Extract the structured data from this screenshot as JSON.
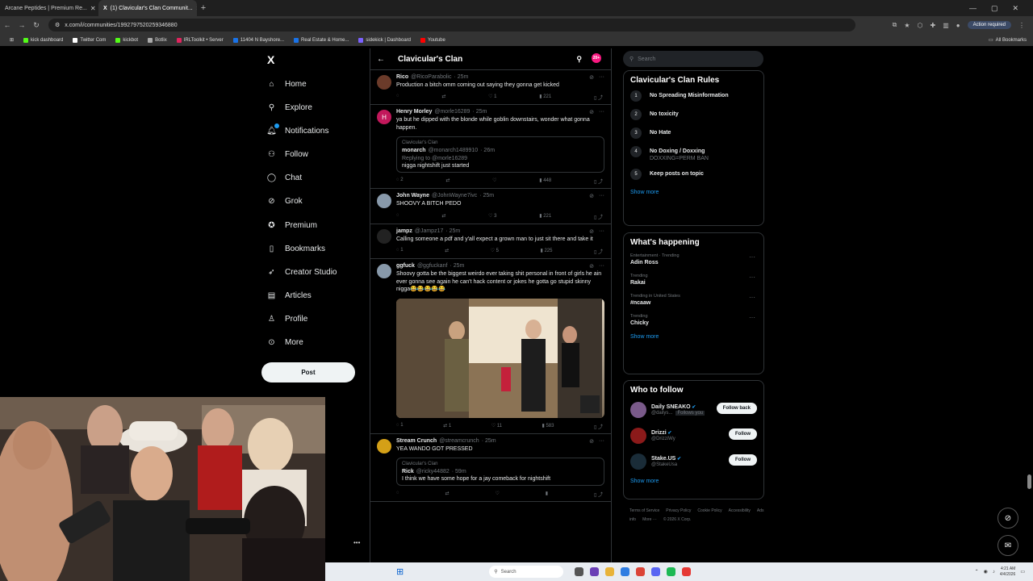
{
  "browser": {
    "tabs": [
      {
        "label": "Arcane Peptides | Premium Re...",
        "active": false
      },
      {
        "label": "(1) Clavicular's Clan Communit...",
        "active": true
      }
    ],
    "url": "x.com/i/communities/1992797520259346880",
    "action_required": "Action required",
    "bookmarks": [
      {
        "label": "kick dashboard",
        "color": "#53fc18"
      },
      {
        "label": "Twitter Com",
        "color": "#ffffff"
      },
      {
        "label": "kickbot",
        "color": "#53fc18"
      },
      {
        "label": "Botlix",
        "color": "#aaaaaa"
      },
      {
        "label": "IRLToolkit • Server",
        "color": "#e0245e"
      },
      {
        "label": "11404 N Bayshore...",
        "color": "#1a73e8"
      },
      {
        "label": "Real Estate & Home...",
        "color": "#1a73e8"
      },
      {
        "label": "sidekick | Dashboard",
        "color": "#7b61ff"
      },
      {
        "label": "Youtube",
        "color": "#ff0000"
      }
    ],
    "all_bookmarks": "All Bookmarks"
  },
  "leftnav": {
    "logo": "X",
    "items": [
      {
        "label": "Home",
        "icon": "home-icon",
        "glyph": "⌂"
      },
      {
        "label": "Explore",
        "icon": "search-icon",
        "glyph": "⚲"
      },
      {
        "label": "Notifications",
        "icon": "bell-icon",
        "glyph": "🔔︎"
      },
      {
        "label": "Follow",
        "icon": "person-plus-icon",
        "glyph": "⚇"
      },
      {
        "label": "Chat",
        "icon": "chat-icon",
        "glyph": "◯"
      },
      {
        "label": "Grok",
        "icon": "grok-icon",
        "glyph": "⊘"
      },
      {
        "label": "Premium",
        "icon": "premium-icon",
        "glyph": "✪"
      },
      {
        "label": "Bookmarks",
        "icon": "bookmark-icon",
        "glyph": "▯"
      },
      {
        "label": "Creator Studio",
        "icon": "rocket-icon",
        "glyph": "➶"
      },
      {
        "label": "Articles",
        "icon": "article-icon",
        "glyph": "▤"
      },
      {
        "label": "Profile",
        "icon": "person-icon",
        "glyph": "♙"
      },
      {
        "label": "More",
        "icon": "more-circle-icon",
        "glyph": "⊙"
      }
    ],
    "post_label": "Post",
    "more_dots": "•••"
  },
  "feed": {
    "title": "Clavicular's Clan",
    "badge": "20+",
    "tweets": [
      {
        "name": "Rico",
        "handle": "@RicoParabolic",
        "time": "· 25m",
        "text": "Production a bitch omm coming out saying they gonna get kicked",
        "replies": "",
        "reposts": "",
        "likes": "1",
        "views": "221",
        "avatar_color": "#6b3b2a",
        "avatar_letter": ""
      },
      {
        "name": "Henry Morley",
        "handle": "@morle16289",
        "time": "· 25m",
        "text": "ya but he dipped with the blonde while goblin downstairs, wonder what gonna happen.",
        "replies": "2",
        "reposts": "",
        "likes": "",
        "views": "448",
        "avatar_color": "#c2185b",
        "avatar_letter": "H",
        "quote": {
          "community": "Clavicular's Clan",
          "name": "monarch",
          "handle": "@monarch1489910",
          "time": "· 26m",
          "reply": "Replying to @morle16289",
          "text": "nigga nightshift just started"
        }
      },
      {
        "name": "John Wayne",
        "handle": "@JohnWayne7ivc",
        "time": "· 25m",
        "text": "SHOOVY A BITCH PEDO",
        "replies": "",
        "reposts": "",
        "likes": "3",
        "views": "221",
        "avatar_color": "#8899aa",
        "avatar_letter": ""
      },
      {
        "name": "jampz",
        "handle": "@Jampz17",
        "time": "· 25m",
        "text": "Calling someone a pdf and y'all expect a grown man to just sit there and take it",
        "replies": "1",
        "reposts": "",
        "likes": "5",
        "views": "225",
        "avatar_color": "#222222",
        "avatar_letter": ""
      },
      {
        "name": "ggfuck",
        "handle": "@ggfuckanf",
        "time": "· 25m",
        "text": "Shoovy gotta be the biggest weirdo ever taking shit personal in front of girls he ain ever gonna see again he can't hack content or jokes he gotta go stupid skinny nigga😂😂😂😂😂",
        "replies": "1",
        "reposts": "1",
        "likes": "11",
        "views": "583",
        "avatar_color": "#8899aa",
        "avatar_letter": "",
        "has_media": true
      },
      {
        "name": "Stream Crunch",
        "handle": "@streamcrunch",
        "time": "· 25m",
        "text": "YEA WANDO GOT PRESSED",
        "replies": "",
        "reposts": "",
        "likes": "",
        "views": "",
        "avatar_color": "#d4a017",
        "avatar_letter": "",
        "quote": {
          "community": "Clavicular's Clan",
          "name": "Rick",
          "handle": "@ricky44882",
          "time": "· 59m",
          "reply": "",
          "text": "I think we have some hope for a jay comeback for nightshift"
        }
      }
    ]
  },
  "right": {
    "search_placeholder": "Search",
    "rules_title": "Clavicular's Clan Rules",
    "rules": [
      {
        "num": "1",
        "title": "No Spreading Misinformation",
        "desc": ""
      },
      {
        "num": "2",
        "title": "No toxicity",
        "desc": ""
      },
      {
        "num": "3",
        "title": "No Hate",
        "desc": ""
      },
      {
        "num": "4",
        "title": "No Doxing / Doxxing",
        "desc": "DOXXING=PERM BAN"
      },
      {
        "num": "5",
        "title": "Keep posts on topic",
        "desc": ""
      }
    ],
    "show_more": "Show more",
    "happening_title": "What's happening",
    "trends": [
      {
        "context": "Entertainment · Trending",
        "name": "Adin Ross"
      },
      {
        "context": "Trending",
        "name": "Rakai"
      },
      {
        "context": "Trending in United States",
        "name": "#ncaaw"
      },
      {
        "context": "Trending",
        "name": "Chicky"
      }
    ],
    "follow_title": "Who to follow",
    "follow": [
      {
        "name": "Daily SNEAKO",
        "handle": "@dailys...",
        "extra": "Follows you",
        "button": "Follow back",
        "color": "#7a5a8a"
      },
      {
        "name": "Drizzi",
        "handle": "@DrizziWy",
        "extra": "",
        "button": "Follow",
        "color": "#8b1a1a"
      },
      {
        "name": "Stake.US",
        "handle": "@StakeUsa",
        "extra": "",
        "button": "Follow",
        "color": "#1a2c38"
      }
    ],
    "footer": [
      "Terms of Service",
      "Privacy Policy",
      "Cookie Policy",
      "Accessibility",
      "Ads info",
      "More ···",
      "© 2026 X Corp."
    ]
  },
  "taskbar": {
    "search": "Search",
    "time": "4:21 AM",
    "date": "4/4/2026"
  }
}
